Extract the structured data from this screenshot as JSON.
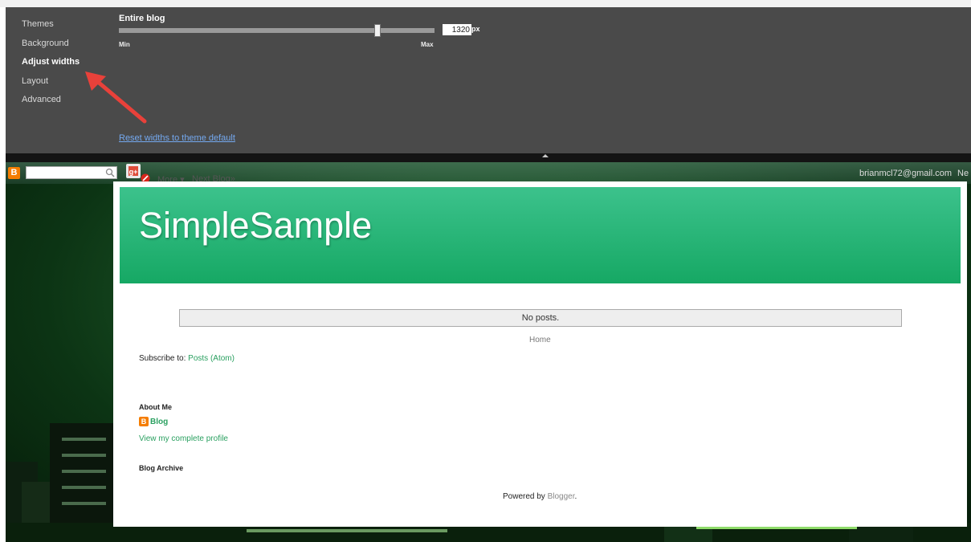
{
  "designer": {
    "nav_items": [
      "Themes",
      "Background",
      "Adjust widths",
      "Layout",
      "Advanced"
    ],
    "active_item": "Adjust widths",
    "section_title": "Entire blog",
    "slider": {
      "min_label": "Min",
      "max_label": "Max",
      "value_fraction": 0.82
    },
    "width_value": "1320",
    "unit": "px",
    "reset_label": "Reset widths to theme default",
    "annotation_color": "#e8413a"
  },
  "navbar": {
    "more_label": "More ▾",
    "next_label": "Next Blog»",
    "email": "brianmcl72@gmail.com",
    "new_label": "Ne"
  },
  "blog": {
    "title": "SimpleSample",
    "no_posts": "No posts.",
    "home": "Home",
    "subscribe_prefix": "Subscribe to: ",
    "subscribe_link": "Posts (Atom)",
    "about_title": "About Me",
    "about_name": "Blog",
    "profile_link": "View my complete profile",
    "archive_title": "Blog Archive",
    "powered_prefix": "Powered by ",
    "powered_link": "Blogger",
    "powered_suffix": "."
  },
  "colors": {
    "panel": "#4a4a4a",
    "banner_top": "#3cc28c",
    "banner_bottom": "#16a864",
    "blogger_orange": "#f57d00",
    "link_green": "#2aa060"
  }
}
